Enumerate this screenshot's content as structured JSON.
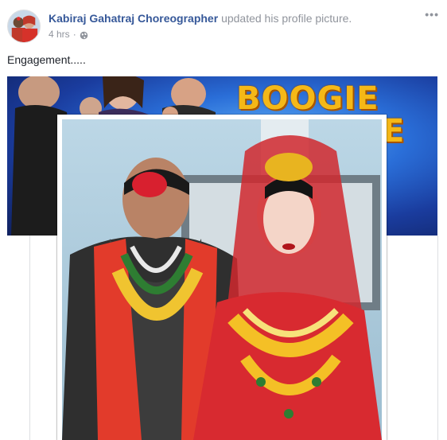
{
  "post": {
    "author": "Kabiraj Gahatraj Choreographer",
    "action": "updated his profile picture.",
    "time": "4 hrs",
    "separator": "·",
    "privacy_icon": "globe-icon",
    "more_label": "•••",
    "caption": "Engagement.....",
    "cover_title_line1": "BOOGIE",
    "cover_title_line2": "E"
  },
  "colors": {
    "author_link": "#365899",
    "meta_text": "#90949c",
    "body_text": "#1d2129",
    "cover_logo": "#f5b817"
  }
}
